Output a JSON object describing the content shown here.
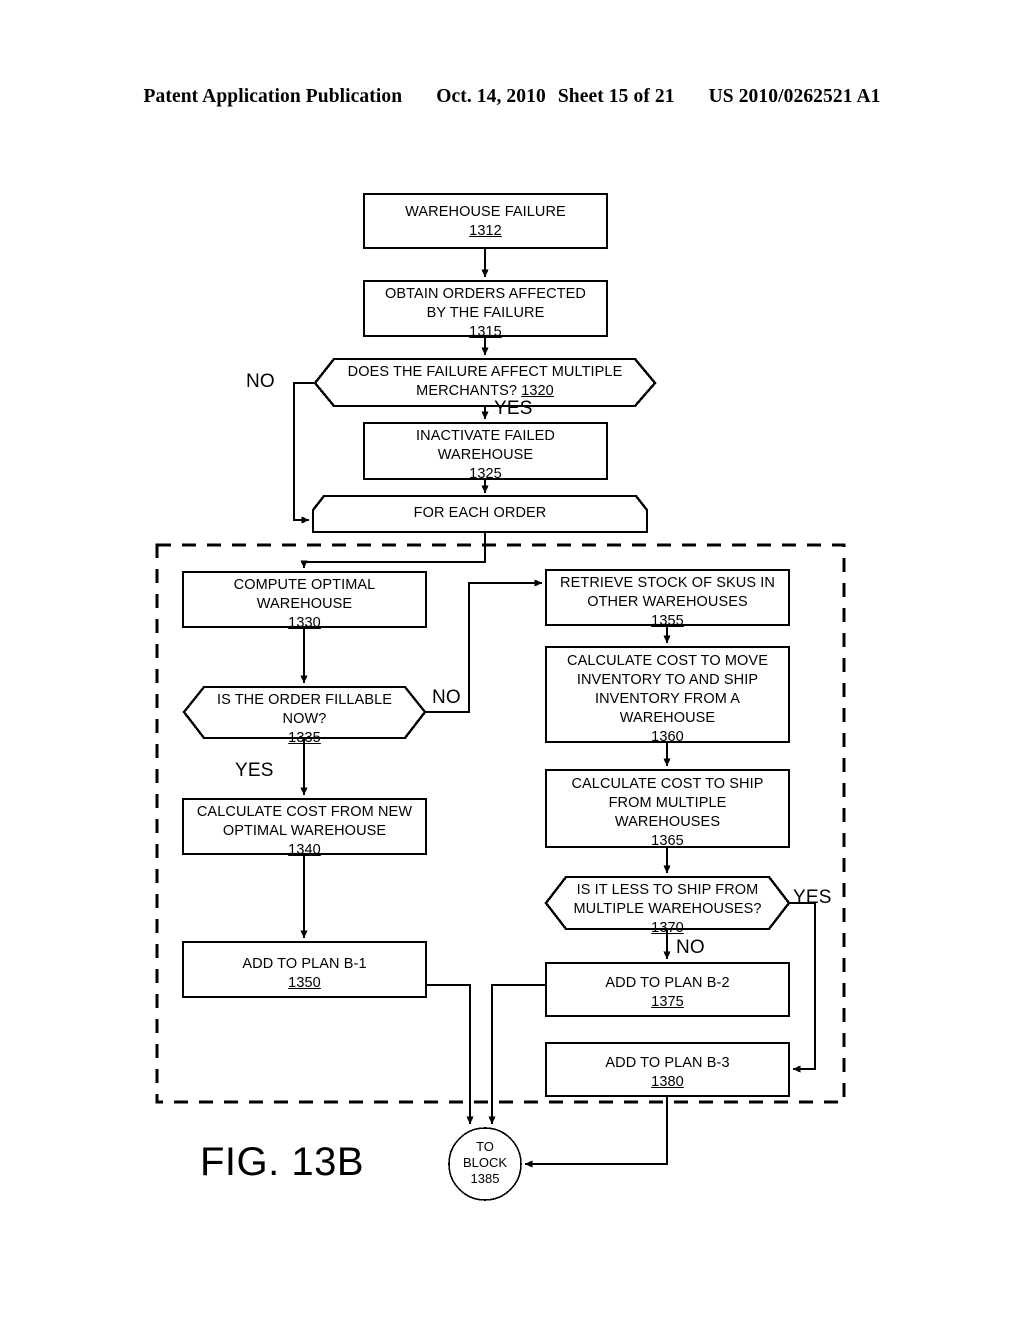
{
  "header": {
    "publication": "Patent Application Publication",
    "date": "Oct. 14, 2010",
    "sheet": "Sheet 15 of 21",
    "document_number": "US 2010/0262521 A1"
  },
  "figure": {
    "caption": "FIG. 13B",
    "line_color": "#000000",
    "background": "#ffffff"
  },
  "nodes": {
    "n1312": {
      "text": "WAREHOUSE FAILURE",
      "ref": "1312",
      "shape": "process"
    },
    "n1315": {
      "line1": "OBTAIN ORDERS AFFECTED",
      "line2": "BY THE FAILURE",
      "ref": "1315",
      "shape": "process"
    },
    "n1320": {
      "line1": "DOES THE FAILURE AFFECT MULTIPLE",
      "line2": "MERCHANTS?",
      "ref": "1320",
      "shape": "decision"
    },
    "n1325": {
      "line1": "INACTIVATE FAILED",
      "line2": "WAREHOUSE",
      "ref": "1325",
      "shape": "process"
    },
    "nForEach": {
      "text": "FOR EACH ORDER",
      "shape": "loop"
    },
    "n1330": {
      "line1": "COMPUTE OPTIMAL",
      "line2": "WAREHOUSE",
      "ref": "1330",
      "shape": "process"
    },
    "n1335": {
      "line1": "IS THE ORDER FILLABLE",
      "line2": "NOW?",
      "ref": "1335",
      "shape": "decision"
    },
    "n1340": {
      "line1": "CALCULATE COST FROM NEW",
      "line2": "OPTIMAL WAREHOUSE",
      "ref": "1340",
      "shape": "process"
    },
    "n1350": {
      "text": "ADD TO PLAN B-1",
      "ref": "1350",
      "shape": "process"
    },
    "n1355": {
      "line1": "RETRIEVE STOCK OF SKUS IN",
      "line2": "OTHER WAREHOUSES",
      "ref": "1355",
      "shape": "process"
    },
    "n1360": {
      "line1": "CALCULATE COST TO MOVE",
      "line2": "INVENTORY TO AND SHIP",
      "line3": "INVENTORY FROM A",
      "line4": "WAREHOUSE",
      "ref": "1360",
      "shape": "process"
    },
    "n1365": {
      "line1": "CALCULATE COST TO SHIP",
      "line2": "FROM MULTIPLE",
      "line3": "WAREHOUSES",
      "ref": "1365",
      "shape": "process"
    },
    "n1370": {
      "line1": "IS IT LESS TO SHIP FROM",
      "line2": "MULTIPLE WAREHOUSES?",
      "ref": "1370",
      "shape": "decision"
    },
    "n1375": {
      "text": "ADD TO PLAN B-2",
      "ref": "1375",
      "shape": "process"
    },
    "n1380": {
      "text": "ADD TO PLAN B-3",
      "ref": "1380",
      "shape": "process"
    },
    "nConnector": {
      "line1": "TO",
      "line2": "BLOCK",
      "line3": "1385",
      "shape": "connector"
    }
  },
  "edge_labels": {
    "no_1320": "NO",
    "yes_1320": "YES",
    "no_1335": "NO",
    "yes_1335": "YES",
    "yes_1370": "YES",
    "no_1370": "NO"
  }
}
